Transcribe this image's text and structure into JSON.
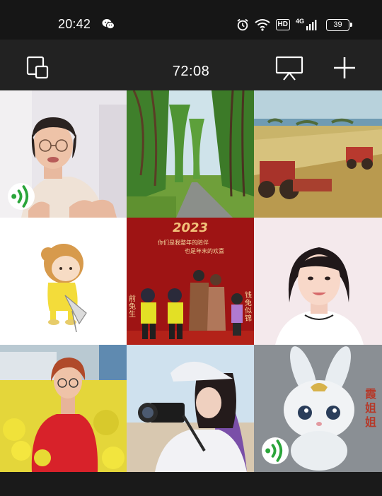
{
  "status_bar": {
    "time": "20:42",
    "hd": "HD",
    "network": "4G",
    "battery": "39",
    "icons": [
      "wechat-icon",
      "alarm-icon",
      "wifi-icon",
      "signal-icon",
      "battery-icon"
    ]
  },
  "toolbar": {
    "timer": "72:08",
    "icons": [
      "switch-camera-icon",
      "screen-share-icon",
      "add-icon"
    ]
  },
  "participants": [
    {
      "id": 1,
      "speaking": true
    },
    {
      "id": 2,
      "speaking": false
    },
    {
      "id": 3,
      "speaking": false
    },
    {
      "id": 4,
      "speaking": false
    },
    {
      "id": 5,
      "speaking": false,
      "year": "2023",
      "caption_1": "你们是我整年的陪伴",
      "caption_2": "也是年末的欢喜",
      "side_left": "前兔生",
      "side_right": "钱兔似锦"
    },
    {
      "id": 6,
      "speaking": false
    },
    {
      "id": 7,
      "speaking": false
    },
    {
      "id": 8,
      "speaking": false
    },
    {
      "id": 9,
      "speaking": true,
      "name_tag": "霞姐姐"
    }
  ],
  "colors": {
    "status_bg": "#161616",
    "toolbar_bg": "#222222",
    "speaking_green": "#2aa53a"
  }
}
